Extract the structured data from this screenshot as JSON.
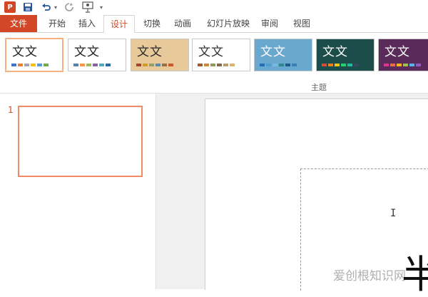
{
  "app": {
    "logo_letter": "P"
  },
  "tabs": [
    {
      "label": "文件"
    },
    {
      "label": "开始"
    },
    {
      "label": "插入"
    },
    {
      "label": "设计"
    },
    {
      "label": "切换"
    },
    {
      "label": "动画"
    },
    {
      "label": "幻灯片放映"
    },
    {
      "label": "审阅"
    },
    {
      "label": "视图"
    }
  ],
  "active_tab": "设计",
  "themes": [
    {
      "label": "文文",
      "bg": "#ffffff",
      "text_color": "#222222",
      "swatches": [
        "#4472c4",
        "#ed7d31",
        "#a5a5a5",
        "#ffc000",
        "#5b9bd5",
        "#70ad47"
      ]
    },
    {
      "label": "文文",
      "bg": "#ffffff",
      "text_color": "#222222",
      "swatches": [
        "#4f81bd",
        "#f79646",
        "#9bbb59",
        "#8064a2",
        "#4bacc6",
        "#2c6aa0"
      ]
    },
    {
      "label": "文文",
      "bg": "#e7c99a",
      "text_color": "#2a2a2a",
      "swatches": [
        "#a7422d",
        "#d09a2f",
        "#8ba06b",
        "#5c8aa8",
        "#9c6f43",
        "#c45b2f"
      ]
    },
    {
      "label": "文文",
      "bg": "#ffffff",
      "text_color": "#333333",
      "swatches": [
        "#a55a2b",
        "#c68b42",
        "#8b9c5d",
        "#7f6a4e",
        "#b4a06a",
        "#d4b575"
      ]
    },
    {
      "label": "文文",
      "bg": "#6aa8cf",
      "text_color": "#ffffff",
      "swatches": [
        "#1f6fb2",
        "#4aa0d6",
        "#77b7e0",
        "#2d8a8a",
        "#1e5a8a",
        "#3b7fb8"
      ]
    },
    {
      "label": "文文",
      "bg": "#1d4d4a",
      "text_color": "#ffffff",
      "swatches": [
        "#e0483b",
        "#e67e22",
        "#f1c40f",
        "#2ecc71",
        "#1abc9c",
        "#34495e"
      ]
    },
    {
      "label": "文文",
      "bg": "#5a2a5a",
      "text_color": "#ffffff",
      "swatches": [
        "#d63a8c",
        "#f26b3a",
        "#f6b21b",
        "#9bc53d",
        "#5ab3e6",
        "#8e5ec0"
      ]
    }
  ],
  "ribbon_group_label": "主题",
  "slides": [
    {
      "number": "1"
    }
  ],
  "watermark": "爱创根知识网",
  "partial_char": "半"
}
